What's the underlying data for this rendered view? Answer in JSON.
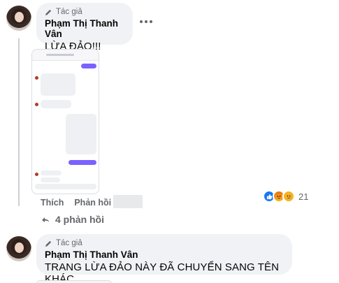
{
  "comments": [
    {
      "author_badge": "Tác giả",
      "author_name": "Phạm Thị Thanh Vân",
      "text": "LỪA ĐẢO!!!",
      "actions": {
        "like": "Thích",
        "reply": "Phản hồi"
      },
      "reaction_count": "21",
      "reaction_icons": [
        "like-icon",
        "angry-icon",
        "sad-icon"
      ],
      "replies_label": "4 phản hồi"
    },
    {
      "author_badge": "Tác giả",
      "author_name": "Phạm Thị Thanh Vân",
      "text": "TRANG LỪA ĐẢO NÀY ĐÃ CHUYỂN SANG TÊN KHÁC"
    }
  ],
  "colors": {
    "bubble": "#f0f2f5",
    "secondary_text": "#65676b",
    "like_blue": "#1877f2"
  }
}
